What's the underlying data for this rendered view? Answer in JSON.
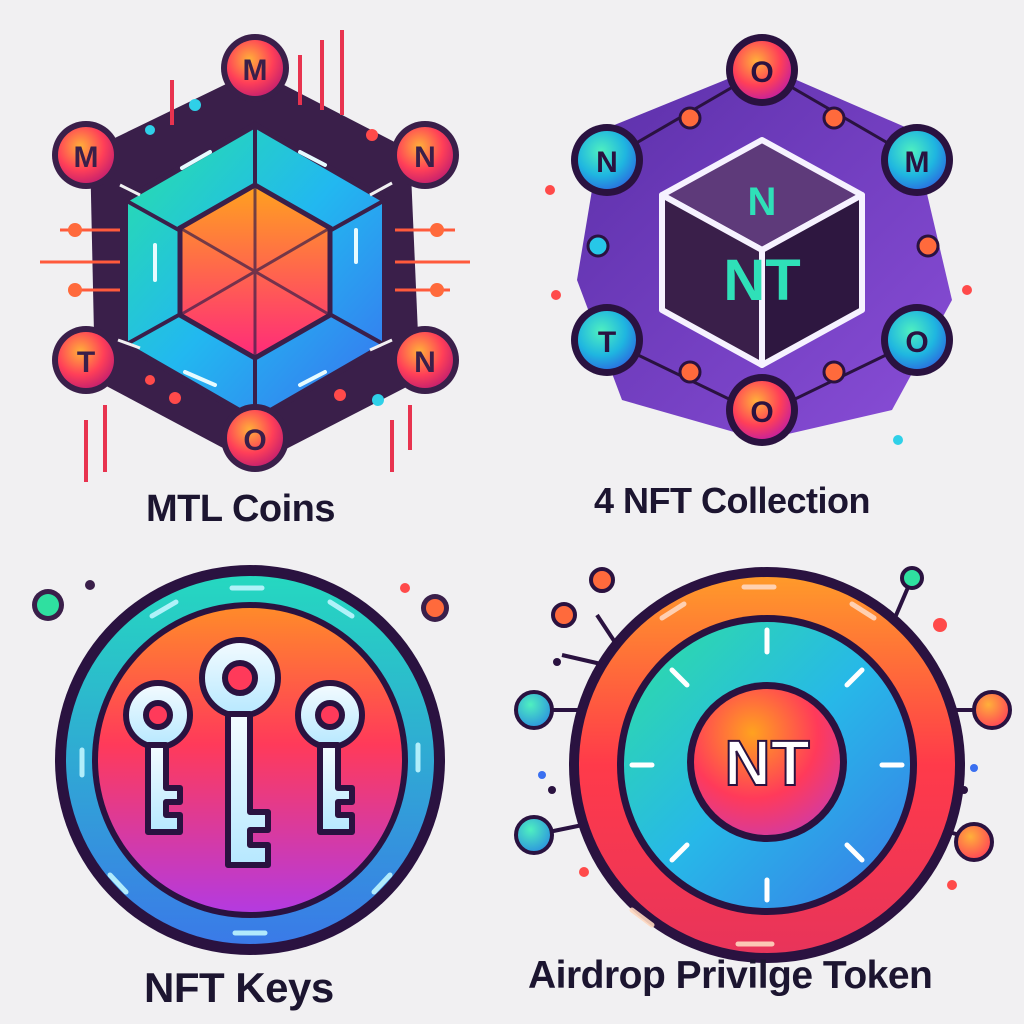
{
  "tiles": [
    {
      "caption": "MTL Coins",
      "icon": "hexagon-network-icon",
      "node_letters": [
        "M",
        "M",
        "N",
        "T",
        "N",
        "O"
      ]
    },
    {
      "caption": "4 NFT Collection",
      "icon": "cube-network-icon",
      "center_letters": [
        "N",
        "NT"
      ],
      "node_letters": [
        "O",
        "N",
        "M",
        "T",
        "O",
        "O"
      ]
    },
    {
      "caption": "NFT Keys",
      "icon": "keys-badge-icon"
    },
    {
      "caption": "Airdrop Privilge Token",
      "icon": "token-badge-icon",
      "center_label": "NT"
    }
  ],
  "colors": {
    "background": "#f1f0f2",
    "caption": "#1c1530",
    "dark_panel": "#3a1f4a",
    "purple_panel": "#6a3fb8",
    "node_red": "#e8334f",
    "node_orange": "#ff8a2a",
    "cyan": "#27c7e8",
    "green": "#2fe0a0",
    "magenta": "#c23cd8"
  }
}
